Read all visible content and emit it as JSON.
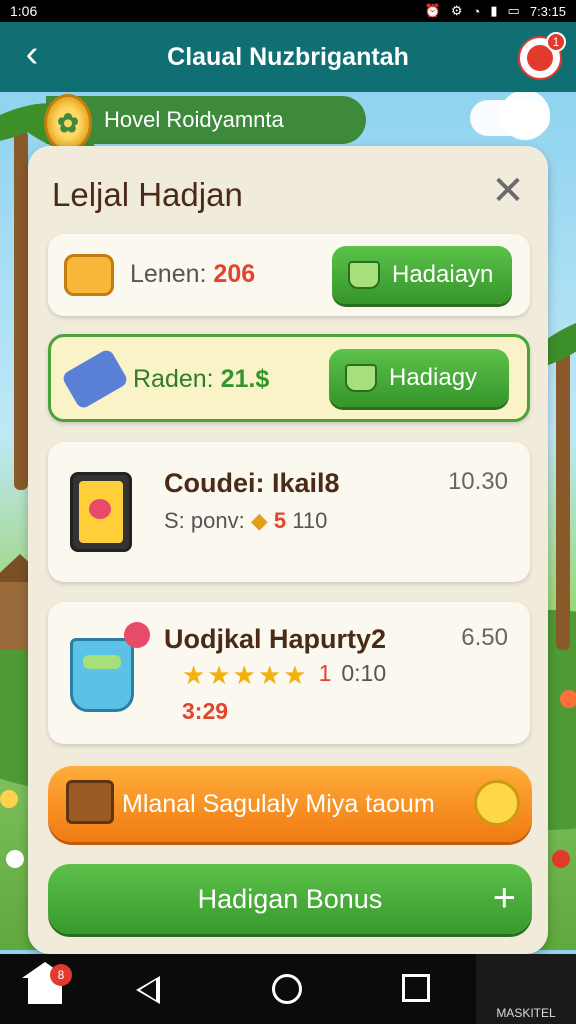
{
  "status_bar": {
    "time_left": "1:06",
    "time_right": "7:3:15"
  },
  "header": {
    "title": "Claual Nuzbrigantah",
    "avatar_badge": "1"
  },
  "level": {
    "banner_text": "Hovel Roidyamnta"
  },
  "panel": {
    "title": "Leljal Hadjan",
    "row1": {
      "label": "Lenen:",
      "value": "206",
      "button": "Hadaiayn"
    },
    "row2": {
      "label": "Raden:",
      "value": "21.$",
      "button": "Hadiagy"
    },
    "item1": {
      "title": "Coudei: Ikail8",
      "time": "10.30",
      "sub_label": "S: ponv:",
      "sub_value": "5",
      "sub_extra": "110"
    },
    "item2": {
      "title": "Uodjkal Hapurty2",
      "time": "6.50",
      "rating_count": "1",
      "rating_extra": "0:10",
      "timer": "3:29",
      "stars": 5
    },
    "banner": "Mlanal Sagulaly Miya taoum",
    "bonus_button": "Hadigan Bonus"
  },
  "navbar": {
    "home_badge": "8",
    "corner_label": "MASKITEL"
  },
  "colors": {
    "header": "#0f6f72",
    "green": "#3d8a3a",
    "orange": "#f07a12",
    "panel": "#f1ebdc"
  }
}
